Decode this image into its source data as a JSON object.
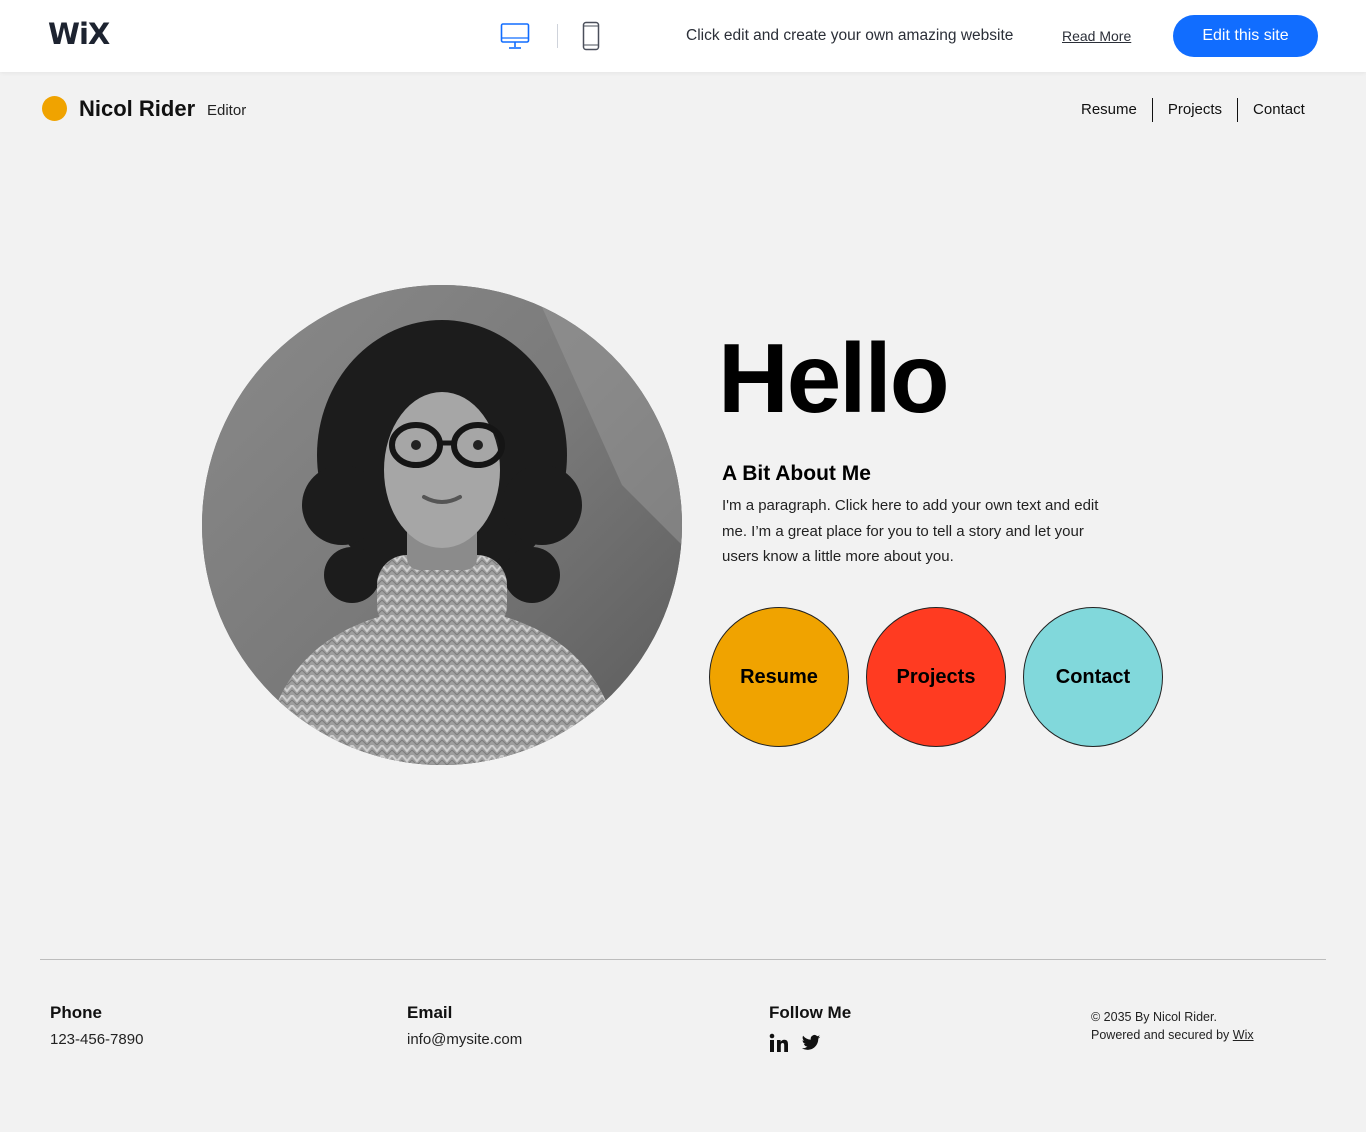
{
  "wix_bar": {
    "logo": "WiX",
    "promo_text": "Click edit and create your own amazing website",
    "read_more": "Read More",
    "edit_button": "Edit this site"
  },
  "site": {
    "name": "Nicol Rider",
    "role": "Editor",
    "nav": [
      "Resume",
      "Projects",
      "Contact"
    ]
  },
  "hero": {
    "greeting": "Hello",
    "about_heading": "A Bit About Me",
    "about_text": "I'm a paragraph. Click here to add your own text and edit me. I’m a great place for you to tell a story and let your users know a little more about you.",
    "buttons": [
      {
        "label": "Resume",
        "color": "#f0a300"
      },
      {
        "label": "Projects",
        "color": "#ff3b21"
      },
      {
        "label": "Contact",
        "color": "#81d8db"
      }
    ]
  },
  "footer": {
    "phone_label": "Phone",
    "phone": "123-456-7890",
    "email_label": "Email",
    "email": "info@mysite.com",
    "follow_label": "Follow Me",
    "social_icons": [
      "linkedin-icon",
      "twitter-icon"
    ],
    "copyright_line": "© 2035 By Nicol Rider.",
    "powered_prefix": "Powered and secured by ",
    "powered_link": "Wix"
  },
  "colors": {
    "accent_blue": "#116dff",
    "dot_orange": "#f0a300"
  }
}
